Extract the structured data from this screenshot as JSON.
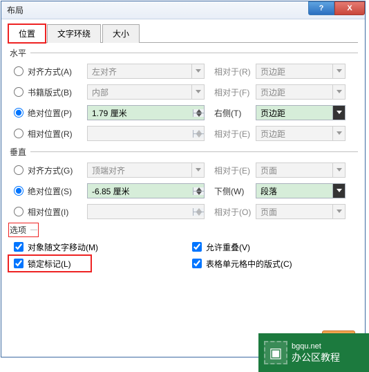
{
  "window": {
    "title": "布局",
    "help_icon": "?",
    "close_icon": "X"
  },
  "tabs": [
    {
      "label": "位置",
      "active": true
    },
    {
      "label": "文字环绕",
      "active": false
    },
    {
      "label": "大小",
      "active": false
    }
  ],
  "horizontal": {
    "heading": "水平",
    "align": {
      "label": "对齐方式(A)",
      "value": "左对齐",
      "rel_label": "相对于(R)",
      "rel_value": "页边距",
      "selected": false
    },
    "book": {
      "label": "书籍版式(B)",
      "value": "内部",
      "rel_label": "相对于(F)",
      "rel_value": "页边距",
      "selected": false
    },
    "abs": {
      "label": "绝对位置(P)",
      "value": "1.79 厘米",
      "rel_label": "右侧(T)",
      "rel_value": "页边距",
      "selected": true
    },
    "rel": {
      "label": "相对位置(R)",
      "value": "",
      "rel_label": "相对于(E)",
      "rel_value": "页边距",
      "selected": false
    }
  },
  "vertical": {
    "heading": "垂直",
    "align": {
      "label": "对齐方式(G)",
      "value": "顶端对齐",
      "rel_label": "相对于(E)",
      "rel_value": "页面",
      "selected": false
    },
    "abs": {
      "label": "绝对位置(S)",
      "value": "-6.85 厘米",
      "rel_label": "下侧(W)",
      "rel_value": "段落",
      "selected": true
    },
    "rel": {
      "label": "相对位置(I)",
      "value": "",
      "rel_label": "相对于(O)",
      "rel_value": "页面",
      "selected": false
    }
  },
  "options": {
    "heading": "选项",
    "move_with_text": {
      "label": "对象随文字移动(M)",
      "checked": true
    },
    "lock_anchor": {
      "label": "锁定标记(L)",
      "checked": true
    },
    "allow_overlap": {
      "label": "允许重叠(V)",
      "checked": true
    },
    "table_cell": {
      "label": "表格单元格中的版式(C)",
      "checked": true
    }
  },
  "watermark": {
    "site": "bgqu.net",
    "name": "办公区教程"
  }
}
